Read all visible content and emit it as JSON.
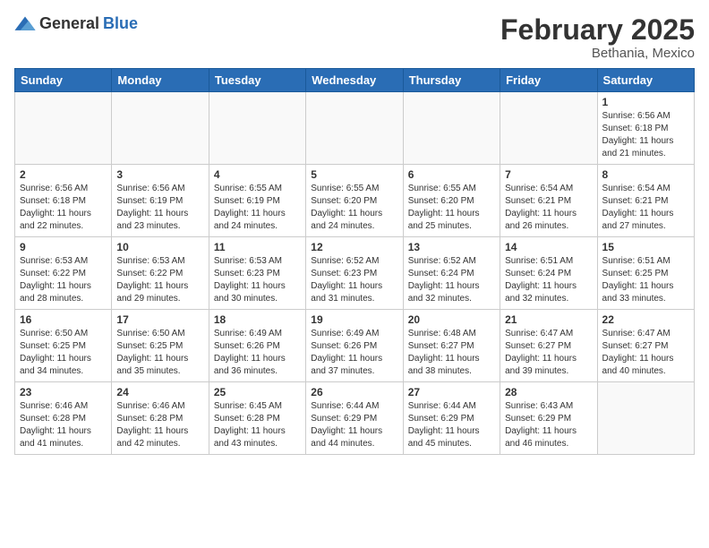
{
  "header": {
    "logo_general": "General",
    "logo_blue": "Blue",
    "month_title": "February 2025",
    "location": "Bethania, Mexico"
  },
  "calendar": {
    "days_of_week": [
      "Sunday",
      "Monday",
      "Tuesday",
      "Wednesday",
      "Thursday",
      "Friday",
      "Saturday"
    ],
    "weeks": [
      [
        {
          "day": "",
          "empty": true
        },
        {
          "day": "",
          "empty": true
        },
        {
          "day": "",
          "empty": true
        },
        {
          "day": "",
          "empty": true
        },
        {
          "day": "",
          "empty": true
        },
        {
          "day": "",
          "empty": true
        },
        {
          "day": "1",
          "sunrise": "6:56 AM",
          "sunset": "6:18 PM",
          "daylight": "11 hours and 21 minutes."
        }
      ],
      [
        {
          "day": "2",
          "sunrise": "6:56 AM",
          "sunset": "6:18 PM",
          "daylight": "11 hours and 22 minutes."
        },
        {
          "day": "3",
          "sunrise": "6:56 AM",
          "sunset": "6:19 PM",
          "daylight": "11 hours and 23 minutes."
        },
        {
          "day": "4",
          "sunrise": "6:55 AM",
          "sunset": "6:19 PM",
          "daylight": "11 hours and 24 minutes."
        },
        {
          "day": "5",
          "sunrise": "6:55 AM",
          "sunset": "6:20 PM",
          "daylight": "11 hours and 24 minutes."
        },
        {
          "day": "6",
          "sunrise": "6:55 AM",
          "sunset": "6:20 PM",
          "daylight": "11 hours and 25 minutes."
        },
        {
          "day": "7",
          "sunrise": "6:54 AM",
          "sunset": "6:21 PM",
          "daylight": "11 hours and 26 minutes."
        },
        {
          "day": "8",
          "sunrise": "6:54 AM",
          "sunset": "6:21 PM",
          "daylight": "11 hours and 27 minutes."
        }
      ],
      [
        {
          "day": "9",
          "sunrise": "6:53 AM",
          "sunset": "6:22 PM",
          "daylight": "11 hours and 28 minutes."
        },
        {
          "day": "10",
          "sunrise": "6:53 AM",
          "sunset": "6:22 PM",
          "daylight": "11 hours and 29 minutes."
        },
        {
          "day": "11",
          "sunrise": "6:53 AM",
          "sunset": "6:23 PM",
          "daylight": "11 hours and 30 minutes."
        },
        {
          "day": "12",
          "sunrise": "6:52 AM",
          "sunset": "6:23 PM",
          "daylight": "11 hours and 31 minutes."
        },
        {
          "day": "13",
          "sunrise": "6:52 AM",
          "sunset": "6:24 PM",
          "daylight": "11 hours and 32 minutes."
        },
        {
          "day": "14",
          "sunrise": "6:51 AM",
          "sunset": "6:24 PM",
          "daylight": "11 hours and 32 minutes."
        },
        {
          "day": "15",
          "sunrise": "6:51 AM",
          "sunset": "6:25 PM",
          "daylight": "11 hours and 33 minutes."
        }
      ],
      [
        {
          "day": "16",
          "sunrise": "6:50 AM",
          "sunset": "6:25 PM",
          "daylight": "11 hours and 34 minutes."
        },
        {
          "day": "17",
          "sunrise": "6:50 AM",
          "sunset": "6:25 PM",
          "daylight": "11 hours and 35 minutes."
        },
        {
          "day": "18",
          "sunrise": "6:49 AM",
          "sunset": "6:26 PM",
          "daylight": "11 hours and 36 minutes."
        },
        {
          "day": "19",
          "sunrise": "6:49 AM",
          "sunset": "6:26 PM",
          "daylight": "11 hours and 37 minutes."
        },
        {
          "day": "20",
          "sunrise": "6:48 AM",
          "sunset": "6:27 PM",
          "daylight": "11 hours and 38 minutes."
        },
        {
          "day": "21",
          "sunrise": "6:47 AM",
          "sunset": "6:27 PM",
          "daylight": "11 hours and 39 minutes."
        },
        {
          "day": "22",
          "sunrise": "6:47 AM",
          "sunset": "6:27 PM",
          "daylight": "11 hours and 40 minutes."
        }
      ],
      [
        {
          "day": "23",
          "sunrise": "6:46 AM",
          "sunset": "6:28 PM",
          "daylight": "11 hours and 41 minutes."
        },
        {
          "day": "24",
          "sunrise": "6:46 AM",
          "sunset": "6:28 PM",
          "daylight": "11 hours and 42 minutes."
        },
        {
          "day": "25",
          "sunrise": "6:45 AM",
          "sunset": "6:28 PM",
          "daylight": "11 hours and 43 minutes."
        },
        {
          "day": "26",
          "sunrise": "6:44 AM",
          "sunset": "6:29 PM",
          "daylight": "11 hours and 44 minutes."
        },
        {
          "day": "27",
          "sunrise": "6:44 AM",
          "sunset": "6:29 PM",
          "daylight": "11 hours and 45 minutes."
        },
        {
          "day": "28",
          "sunrise": "6:43 AM",
          "sunset": "6:29 PM",
          "daylight": "11 hours and 46 minutes."
        },
        {
          "day": "",
          "empty": true
        }
      ]
    ]
  }
}
